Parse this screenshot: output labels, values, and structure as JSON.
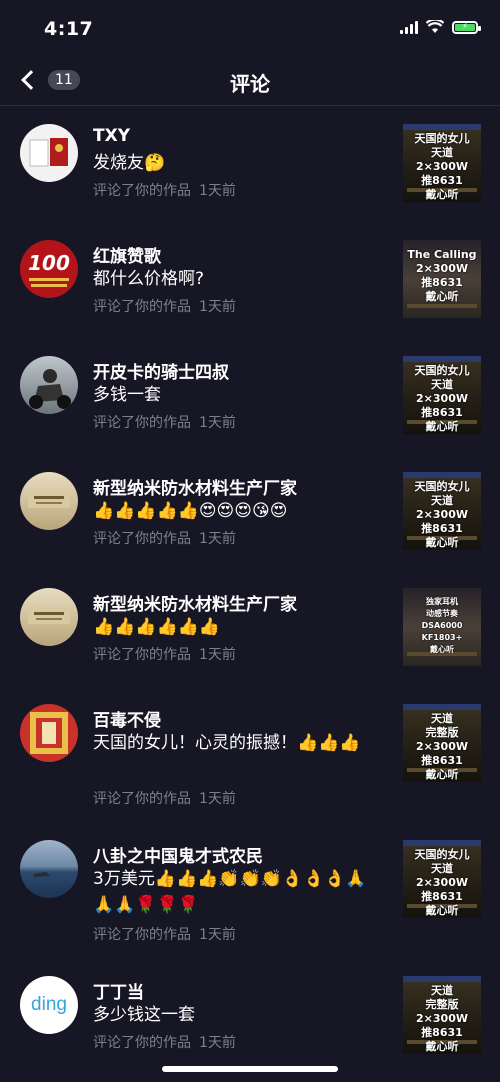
{
  "status": {
    "time": "4:17"
  },
  "header": {
    "count": "11",
    "title": "评论"
  },
  "meta_action": "评论了你的作品",
  "comments": [
    {
      "name": "TXY",
      "text": "发烧友🤔",
      "time": "1天前",
      "thumb": "天国的女儿\n天道\n2×300W\n推8631\n戴心听"
    },
    {
      "name": "红旗赞歌",
      "text": "都什么价格啊?",
      "time": "1天前",
      "thumb": "The Calling\n2×300W\n推8631\n戴心听"
    },
    {
      "name": "开皮卡的骑士四叔",
      "text": "多钱一套",
      "time": "1天前",
      "thumb": "天国的女儿\n天道\n2×300W\n推8631\n戴心听"
    },
    {
      "name": "新型纳米防水材料生产厂家",
      "text": "👍👍👍👍👍😍😍😍😘😍",
      "time": "1天前",
      "thumb": "天国的女儿\n天道\n2×300W\n推8631\n戴心听"
    },
    {
      "name": "新型纳米防水材料生产厂家",
      "text": "👍👍👍👍👍👍",
      "time": "1天前",
      "thumb": "独家耳机\n动感节奏\nDSA6000\nKF1803+\n戴心听"
    },
    {
      "name": "百毒不侵",
      "text": "天国的女儿！心灵的振撼！👍👍👍",
      "time": "1天前",
      "thumb": "天道\n完整版\n2×300W\n推8631\n戴心听"
    },
    {
      "name": "八卦之中国鬼才式农民",
      "text": "3万美元👍👍👍👏👏👏👌👌👌🙏🙏🙏🌹🌹🌹",
      "time": "1天前",
      "thumb": "天国的女儿\n天道\n2×300W\n推8631\n戴心听"
    },
    {
      "name": "丁丁当",
      "text": "多少钱这一套",
      "time": "1天前",
      "thumb": "天道\n完整版\n2×300W\n推8631\n戴心听"
    }
  ],
  "avatar_labels": {
    "a2": "100",
    "a8": "ding"
  },
  "colors": {
    "background": "#161624",
    "meta": "#7f7f8c",
    "divider": "#2c2c3b"
  }
}
